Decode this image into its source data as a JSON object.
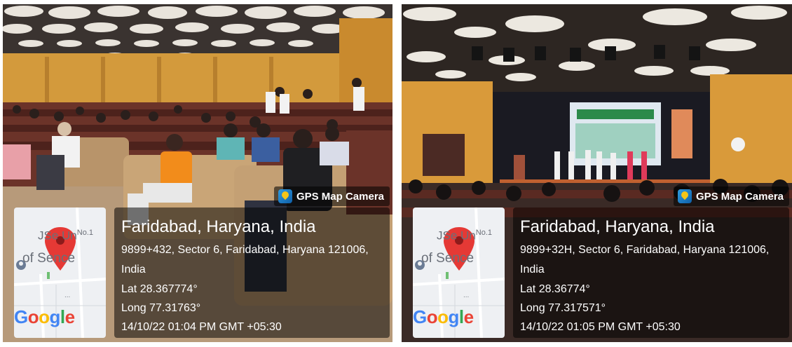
{
  "photos": [
    {
      "gps_tag": "GPS Map Camera",
      "map_label_1": "JS",
      "map_label_1b": "e Un",
      "map_sup": "No.1",
      "map_label_2": "of S",
      "map_label_2b": "ence",
      "google": "Google",
      "title": "Faridabad, Haryana, India",
      "address": "9899+432, Sector 6, Faridabad, Haryana 121006,",
      "country": "India",
      "lat": "Lat 28.367774°",
      "long": "Long 77.31763°",
      "datetime": "14/10/22 01:04 PM GMT +05:30"
    },
    {
      "gps_tag": "GPS Map Camera",
      "map_label_1": "JS",
      "map_label_1b": "e Un",
      "map_sup": "No.1",
      "map_label_2": "of S",
      "map_label_2b": "ence",
      "google": "Google",
      "title": "Faridabad, Haryana, India",
      "address": "9899+32H, Sector 6, Faridabad, Haryana 121006,",
      "country": "India",
      "lat": "Lat 28.36774°",
      "long": "Long 77.317571°",
      "datetime": "14/10/22 01:05 PM GMT +05:30"
    }
  ],
  "colors": {
    "pin": "#e53935",
    "google_blue": "#4285F4",
    "google_red": "#EA4335",
    "google_yellow": "#FBBC05",
    "google_green": "#34A853",
    "wall": "#d39a3c",
    "seat": "#5c2a22"
  }
}
